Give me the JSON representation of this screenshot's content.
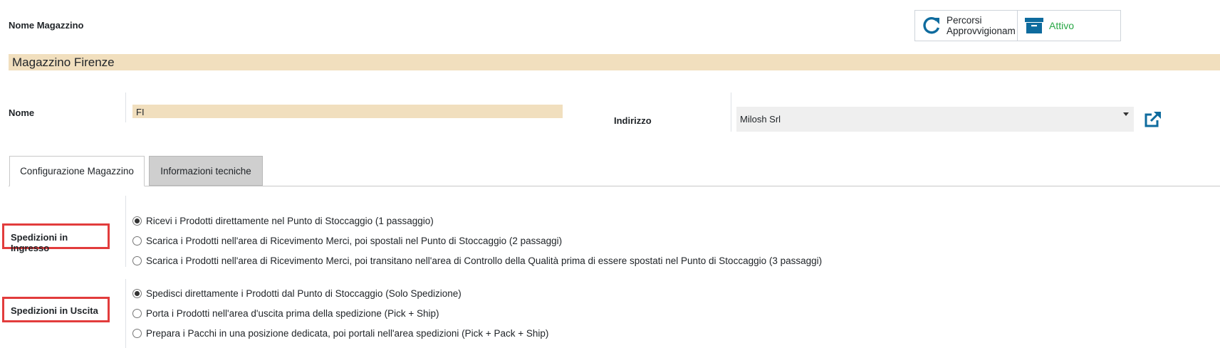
{
  "header": {
    "warehouse_name_label": "Nome Magazzino",
    "title": "Magazzino Firenze"
  },
  "smart_buttons": {
    "routes_line1": "Percorsi",
    "routes_line2": "Approvvigionam",
    "active_label": "Attivo"
  },
  "form": {
    "nome_label": "Nome",
    "nome_value": "FI",
    "indirizzo_label": "Indirizzo",
    "indirizzo_value": "Milosh Srl"
  },
  "tabs": [
    {
      "label": "Configurazione Magazzino",
      "active": true
    },
    {
      "label": "Informazioni tecniche",
      "active": false
    }
  ],
  "incoming": {
    "label": "Spedizioni in Ingresso",
    "options": [
      {
        "label": "Ricevi i Prodotti direttamente nel Punto di Stoccaggio (1 passaggio)",
        "checked": true
      },
      {
        "label": "Scarica i Prodotti nell'area di Ricevimento Merci, poi spostali nel Punto di Stoccaggio (2 passaggi)",
        "checked": false
      },
      {
        "label": "Scarica i Prodotti nell'area di Ricevimento Merci, poi transitano nell'area di Controllo della Qualità prima di essere spostati nel Punto di Stoccaggio (3 passaggi)",
        "checked": false
      }
    ]
  },
  "outgoing": {
    "label": "Spedizioni in Uscita",
    "options": [
      {
        "label": "Spedisci direttamente i Prodotti dal Punto di Stoccaggio (Solo Spedizione)",
        "checked": true
      },
      {
        "label": "Porta i Prodotti nell'area d'uscita prima della spedizione (Pick + Ship)",
        "checked": false
      },
      {
        "label": "Prepara i Pacchi in una posizione dedicata, poi portali nell'area spedizioni (Pick + Pack + Ship)",
        "checked": false
      }
    ]
  },
  "colors": {
    "required_field_bg": "#f1dfbe",
    "primary_icon": "#0e6b9e",
    "active_green": "#28a745",
    "highlight_red": "#e23c3c"
  },
  "icons": {
    "routes": "refresh-icon",
    "active": "archive-icon",
    "external_link": "external-link-icon",
    "dropdown": "caret-down-icon"
  }
}
